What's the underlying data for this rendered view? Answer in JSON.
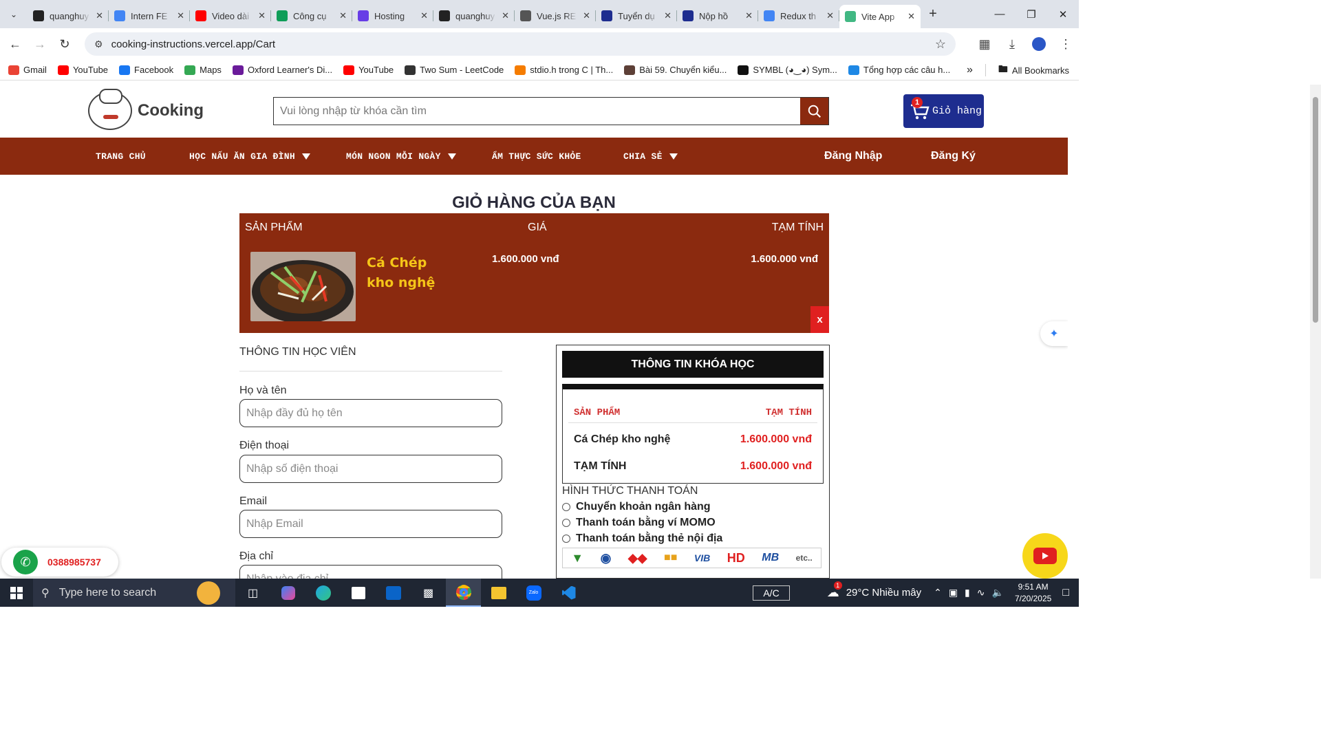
{
  "browser": {
    "tabs": [
      {
        "title": "quanghuy",
        "fav_color": "#222",
        "fav_icon": "github-icon"
      },
      {
        "title": "Intern FE",
        "fav_color": "#4285f4",
        "fav_icon": "docs-icon"
      },
      {
        "title": "Video dài",
        "fav_color": "#ff0000",
        "fav_icon": "youtube-icon"
      },
      {
        "title": "Công cụ",
        "fav_color": "#0f9d58",
        "fav_icon": "sheets-icon"
      },
      {
        "title": "Hosting",
        "fav_color": "#673de6",
        "fav_icon": "hostinger-icon"
      },
      {
        "title": "quanghuy",
        "fav_color": "#222",
        "fav_icon": "github-icon"
      },
      {
        "title": "Vue.js RE",
        "fav_color": "#555",
        "fav_icon": "chatgpt-icon"
      },
      {
        "title": "Tuyển dụ",
        "fav_color": "#1e2d8f",
        "fav_icon": "topcv-icon"
      },
      {
        "title": "Nộp hồ",
        "fav_color": "#1e2d8f",
        "fav_icon": "topcv-icon"
      },
      {
        "title": "Redux th",
        "fav_color": "#4285f4",
        "fav_icon": "google-icon"
      },
      {
        "title": "Vite App",
        "fav_color": "#41b883",
        "fav_icon": "vue-icon",
        "active": true
      }
    ],
    "url": "cooking-instructions.vercel.app/Cart",
    "bookmarks": [
      {
        "label": "Gmail",
        "color": "#ea4335",
        "icon": "gmail-icon"
      },
      {
        "label": "YouTube",
        "color": "#ff0000",
        "icon": "youtube-icon"
      },
      {
        "label": "Facebook",
        "color": "#1877f2",
        "icon": "facebook-icon"
      },
      {
        "label": "Maps",
        "color": "#34a853",
        "icon": "maps-icon"
      },
      {
        "label": "Oxford Learner's Di...",
        "color": "#6a1b9a",
        "icon": "oxford-icon"
      },
      {
        "label": "YouTube",
        "color": "#ff0000",
        "icon": "youtube-icon"
      },
      {
        "label": "Two Sum - LeetCode",
        "color": "#333",
        "icon": "leetcode-icon"
      },
      {
        "label": "stdio.h trong C | Th...",
        "color": "#f57c00",
        "icon": "j-icon"
      },
      {
        "label": "Bài 59. Chuyển kiểu...",
        "color": "#5d4037",
        "icon": "person-icon"
      },
      {
        "label": "SYMBL (◕‿◕) Sym...",
        "color": "#111",
        "icon": "symbl-icon"
      },
      {
        "label": "Tổng hợp các câu h...",
        "color": "#1e88e5",
        "icon": "diamond-icon"
      }
    ],
    "all_bookmarks": "All Bookmarks"
  },
  "site": {
    "logo_text": "Cooking",
    "search_placeholder": "Vui lòng nhập từ khóa cần tìm",
    "cart_label": "Giỏ hàng",
    "cart_count": "1",
    "nav": [
      {
        "label": "TRANG CHỦ",
        "dropdown": false
      },
      {
        "label": "HỌC NẤU ĂN GIA ĐÌNH",
        "dropdown": true
      },
      {
        "label": "MÓN NGON MỖI NGÀY",
        "dropdown": true
      },
      {
        "label": "ẨM THỰC SỨC KHỎE",
        "dropdown": false
      },
      {
        "label": "CHIA SẺ",
        "dropdown": true
      }
    ],
    "login": "Đăng Nhập",
    "register": "Đăng Ký",
    "brand_color": "#8b2a0f"
  },
  "cart": {
    "title": "GIỎ HÀNG CỦA BẠN",
    "headers": {
      "product": "SẢN PHẨM",
      "price": "GIÁ",
      "subtotal": "TẠM TÍNH"
    },
    "items": [
      {
        "name": "Cá Chép kho nghệ",
        "price": "1.600.000 vnđ",
        "subtotal": "1.600.000 vnđ"
      }
    ],
    "remove_label": "x"
  },
  "student_form": {
    "title": "THÔNG TIN HỌC VIÊN",
    "fields": [
      {
        "label": "Họ và tên",
        "placeholder": "Nhập đầy đủ họ tên"
      },
      {
        "label": "Điện thoại",
        "placeholder": "Nhập số điện thoại"
      },
      {
        "label": "Email",
        "placeholder": "Nhập Email"
      },
      {
        "label": "Địa chỉ",
        "placeholder": "Nhập vào địa chỉ"
      }
    ]
  },
  "course_info": {
    "title": "THÔNG TIN KHÓA HỌC",
    "col_product": "SẢN PHẨM",
    "col_subtotal": "TẠM TÍNH",
    "item_name": "Cá Chép kho nghệ",
    "item_price": "1.600.000 vnđ",
    "total_label": "TẠM TÍNH",
    "total_value": "1.600.000 vnđ"
  },
  "payment": {
    "title": "HÌNH THỨC THANH TOÁN",
    "options": [
      "Chuyển khoản ngân hàng",
      "Thanh toán bằng ví MOMO",
      "Thanh toán bằng thẻ nội địa"
    ],
    "banks": [
      "VIB",
      "HD",
      "MB",
      "etc.."
    ]
  },
  "hotline": "0388985737",
  "taskbar": {
    "search_placeholder": "Type here to search",
    "ac": "A/C",
    "weather": "29°C  Nhiều mây",
    "weather_badge": "1",
    "time": "9:51 AM",
    "date": "7/20/2025"
  }
}
